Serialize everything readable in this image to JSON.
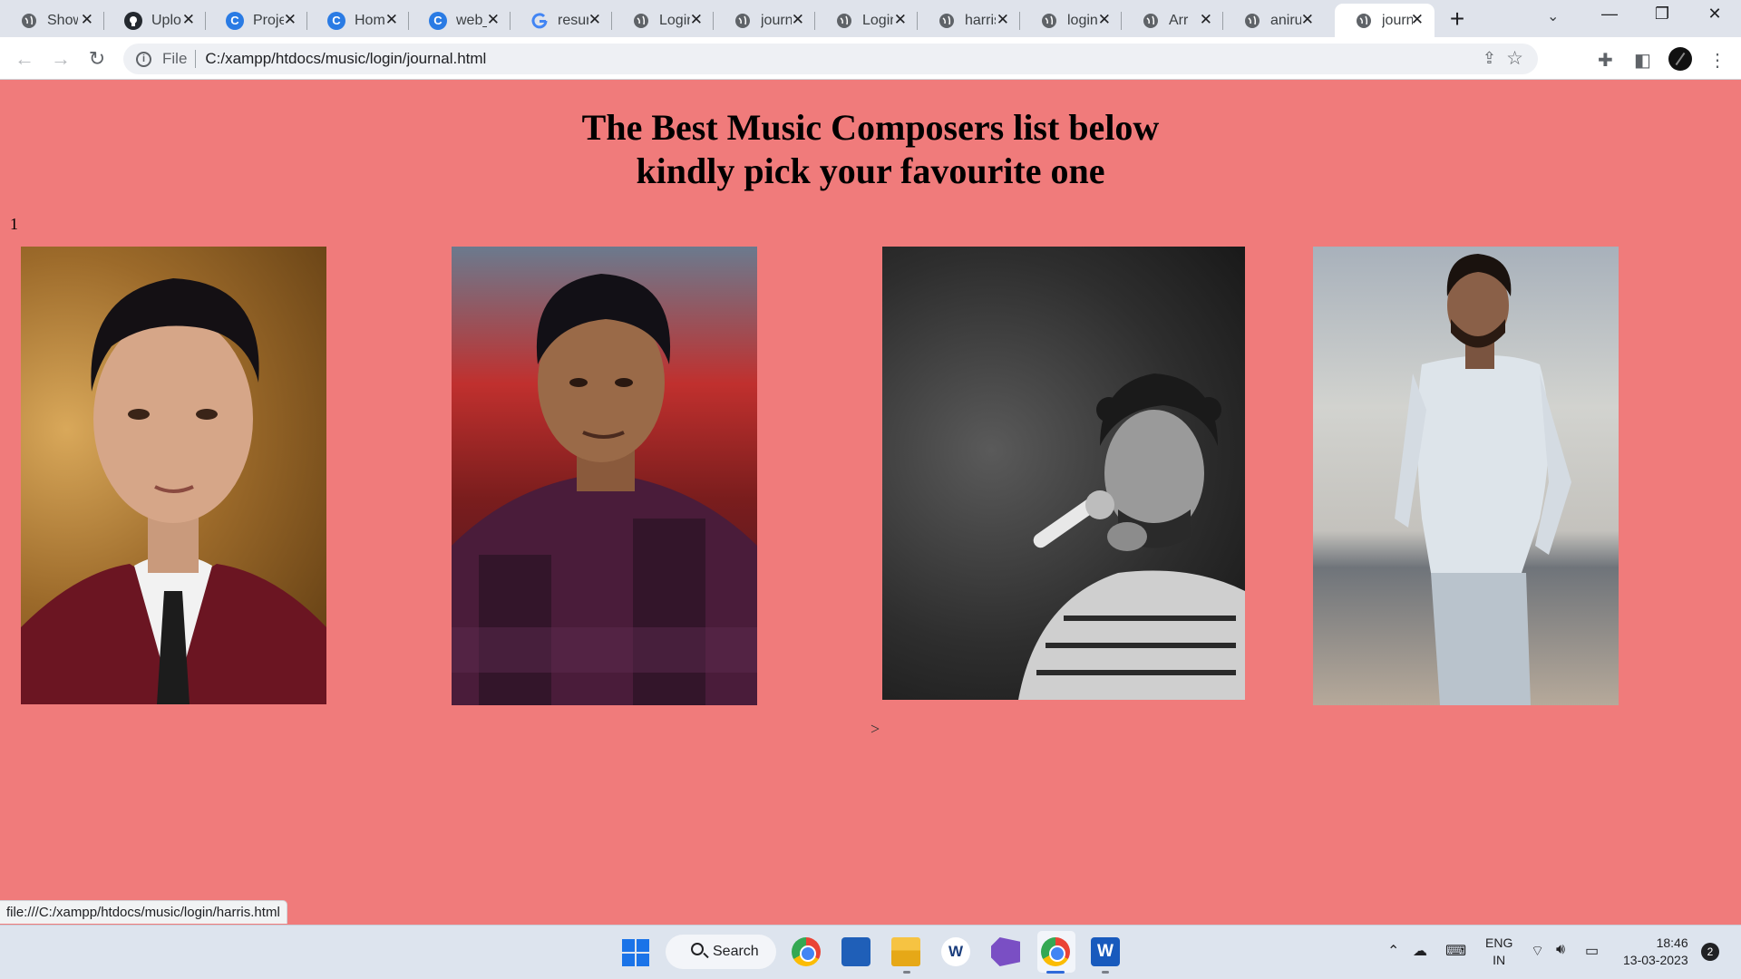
{
  "browser": {
    "tabs": [
      {
        "label": "Show",
        "icon": "globe-icon"
      },
      {
        "label": "Uplo",
        "icon": "github-icon"
      },
      {
        "label": "Proje",
        "icon": "canva-icon"
      },
      {
        "label": "Hom",
        "icon": "canva-icon"
      },
      {
        "label": "web_",
        "icon": "canva-icon"
      },
      {
        "label": "resur",
        "icon": "google-icon"
      },
      {
        "label": "Login",
        "icon": "globe-icon"
      },
      {
        "label": "journ",
        "icon": "globe-icon"
      },
      {
        "label": "Login",
        "icon": "globe-icon"
      },
      {
        "label": "harris",
        "icon": "globe-icon"
      },
      {
        "label": "login",
        "icon": "globe-icon"
      },
      {
        "label": "Arr",
        "icon": "globe-icon"
      },
      {
        "label": "aniru",
        "icon": "globe-icon"
      },
      {
        "label": "journ",
        "icon": "globe-icon",
        "active": true
      }
    ],
    "omnibox": {
      "scheme_chip": "File",
      "url": "C:/xampp/htdocs/music/login/journal.html"
    }
  },
  "page": {
    "heading_line1": "The Best Music Composers list below",
    "heading_line2": "kindly pick your favourite one",
    "number_label": "1",
    "photos": [
      {
        "name": "composer-photo-1",
        "href": "aniru"
      },
      {
        "name": "composer-photo-2",
        "href": "harris"
      },
      {
        "name": "composer-photo-3",
        "href": ""
      },
      {
        "name": "composer-photo-4",
        "href": ""
      }
    ],
    "stray_text": ">"
  },
  "status_bar": {
    "link_url": "file:///C:/xampp/htdocs/music/login/harris.html"
  },
  "taskbar": {
    "search_label": "Search",
    "language_line1": "ENG",
    "language_line2": "IN",
    "time": "18:46",
    "date": "13-03-2023",
    "notification_count": "2"
  },
  "colors": {
    "page_background": "#f07b7b",
    "taskbar_background": "#dde4ee",
    "tabstrip_background": "#dfe3eb"
  }
}
